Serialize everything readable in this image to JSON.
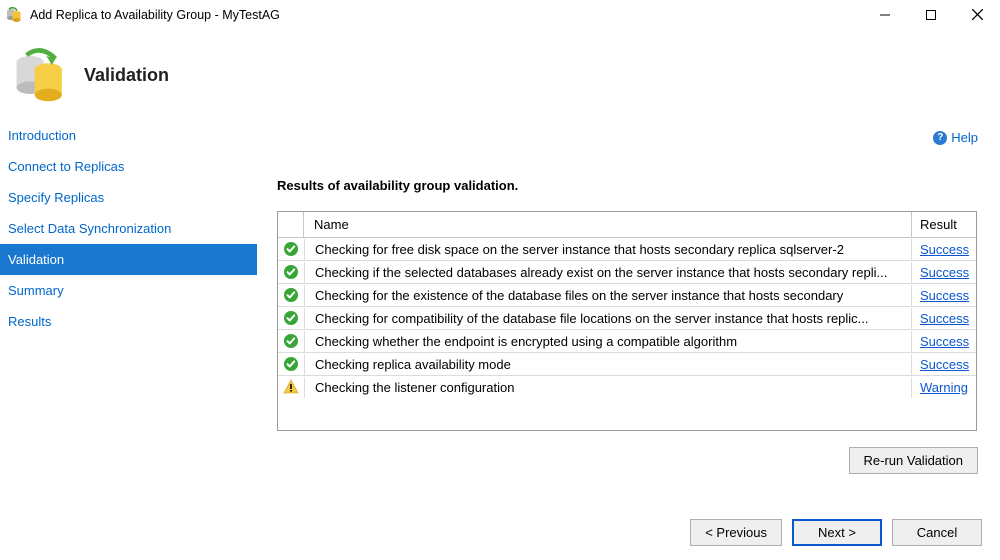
{
  "window": {
    "title": "Add Replica to Availability Group - MyTestAG"
  },
  "header": {
    "title": "Validation"
  },
  "sidebar": {
    "items": [
      {
        "label": "Introduction",
        "current": false
      },
      {
        "label": "Connect to Replicas",
        "current": false
      },
      {
        "label": "Specify Replicas",
        "current": false
      },
      {
        "label": "Select Data Synchronization",
        "current": false
      },
      {
        "label": "Validation",
        "current": true
      },
      {
        "label": "Summary",
        "current": false
      },
      {
        "label": "Results",
        "current": false
      }
    ]
  },
  "help": {
    "label": "Help"
  },
  "results": {
    "heading": "Results of availability group validation.",
    "columns": {
      "name": "Name",
      "result": "Result"
    },
    "rows": [
      {
        "status": "ok",
        "name": "Checking for free disk space on the server instance that hosts secondary replica sqlserver-2",
        "result": "Success"
      },
      {
        "status": "ok",
        "name": "Checking if the selected databases already exist on the server instance that hosts secondary repli...",
        "result": "Success"
      },
      {
        "status": "ok",
        "name": "Checking for the existence of the database files on the server instance that hosts secondary",
        "result": "Success"
      },
      {
        "status": "ok",
        "name": "Checking for compatibility of the database file locations on the server instance that hosts replic...",
        "result": "Success"
      },
      {
        "status": "ok",
        "name": "Checking whether the endpoint is encrypted using a compatible algorithm",
        "result": "Success"
      },
      {
        "status": "ok",
        "name": "Checking replica availability mode",
        "result": "Success"
      },
      {
        "status": "warn",
        "name": "Checking the listener configuration",
        "result": "Warning"
      }
    ]
  },
  "buttons": {
    "rerun": "Re-run Validation",
    "previous": "< Previous",
    "next": "Next >",
    "cancel": "Cancel"
  }
}
